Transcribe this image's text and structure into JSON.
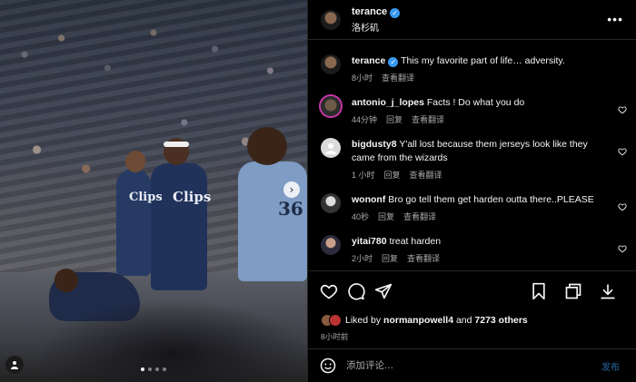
{
  "header": {
    "username": "terance",
    "location": "洛杉矶",
    "more_label": "•••"
  },
  "caption": {
    "username": "terance",
    "text": "This my favorite part of life… adversity.",
    "time": "8小时",
    "translate": "查看翻译"
  },
  "comments": [
    {
      "username": "antonio_j_lopes",
      "text": "Facts ! Do what you do",
      "time": "44分钟",
      "reply": "回复",
      "translate": "查看翻译"
    },
    {
      "username": "bigdusty8",
      "text": "Y'all lost because them jerseys look like they came from the wizards",
      "time": "1 小时",
      "reply": "回复",
      "translate": "查看翻译"
    },
    {
      "username": "wononf",
      "text": "Bro go tell them get harden outta there..PLEASE",
      "time": "40秒",
      "reply": "回复",
      "translate": "查看翻译"
    },
    {
      "username": "yitai780",
      "text": "treat harden",
      "time": "2小时",
      "reply": "回复",
      "translate": "查看翻译"
    }
  ],
  "likes": {
    "prefix": "Liked by ",
    "user": "normanpowell4",
    "and": " and ",
    "others": "7273 others"
  },
  "post_time": "8小时前",
  "add_comment": {
    "placeholder": "添加评论...",
    "post_label": "发布"
  },
  "media": {
    "next_label": "›",
    "slide_count": 4,
    "active_slide": 1,
    "jersey_mid": "Clips",
    "jersey_left": "Clips",
    "jersey_right": "36"
  },
  "colors": {
    "background": "#000000",
    "verified": "#3897f0",
    "muted_text": "#a8a8a8",
    "post_button_disabled": "#1c4a72"
  },
  "icons": [
    "verified-badge-icon",
    "more-options-icon",
    "heart-icon",
    "comment-icon",
    "share-icon",
    "bookmark-icon",
    "repost-icon",
    "download-icon",
    "emoji-icon",
    "next-arrow-icon",
    "user-tag-icon"
  ]
}
